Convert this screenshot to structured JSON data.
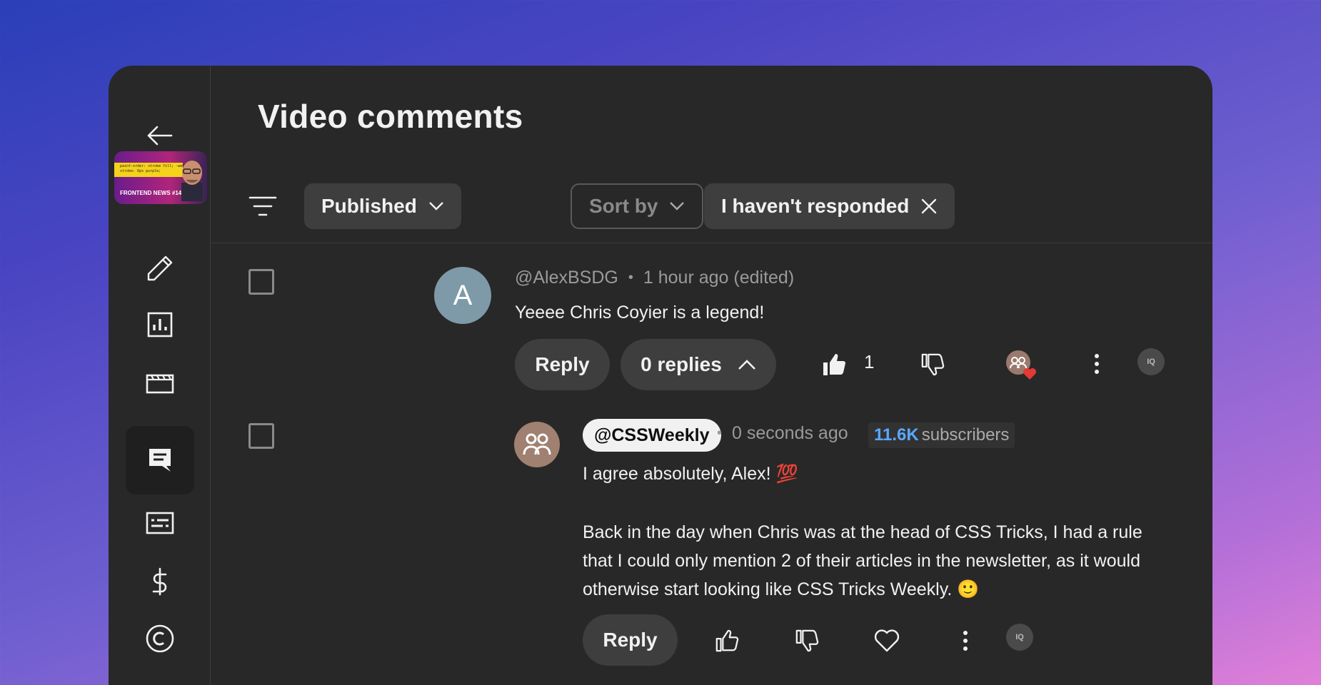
{
  "page": {
    "title": "Video comments"
  },
  "video": {
    "thumbnail_label": "FRONTEND NEWS #14",
    "thumbnail_code": "paint-order: stroke fill; -webkit-text-stroke: 6px purple;"
  },
  "sidebar": {
    "items": [
      {
        "name": "back",
        "icon": "arrow-left-icon"
      },
      {
        "name": "details",
        "icon": "pencil-icon"
      },
      {
        "name": "analytics",
        "icon": "bar-chart-icon"
      },
      {
        "name": "editor",
        "icon": "clapperboard-icon"
      },
      {
        "name": "comments",
        "icon": "comment-icon",
        "active": true
      },
      {
        "name": "subtitles",
        "icon": "subtitles-icon"
      },
      {
        "name": "monetization",
        "icon": "dollar-icon"
      },
      {
        "name": "copyright",
        "icon": "copyright-icon"
      }
    ]
  },
  "filters": {
    "published": "Published",
    "sort_by": "Sort by",
    "responded": "I haven't responded"
  },
  "comments": [
    {
      "author": "@AlexBSDG",
      "avatar_letter": "A",
      "time": "1 hour ago (edited)",
      "text": "Yeeee Chris Coyier is a legend!",
      "reply_label": "Reply",
      "replies_label": "0 replies",
      "likes": "1",
      "moderator_badge": "IQ"
    },
    {
      "author": "@CSSWeekly",
      "time": "0 seconds ago",
      "subscribers_count": "11.6K",
      "subscribers_label": "subscribers",
      "line1": "I agree absolutely, Alex! 💯",
      "line2": "Back in the day when Chris was at the head of CSS Tricks, I had a rule",
      "line3": "that I could only mention 2  of their articles in the newsletter, as it would",
      "line4": "otherwise start looking like CSS Tricks Weekly. 🙂",
      "reply_label": "Reply",
      "moderator_badge": "IQ"
    }
  ],
  "colors": {
    "background_panel": "#282828",
    "chip": "#3e3e3e",
    "accent_link": "#5aa8ff",
    "heart": "#e53935"
  }
}
